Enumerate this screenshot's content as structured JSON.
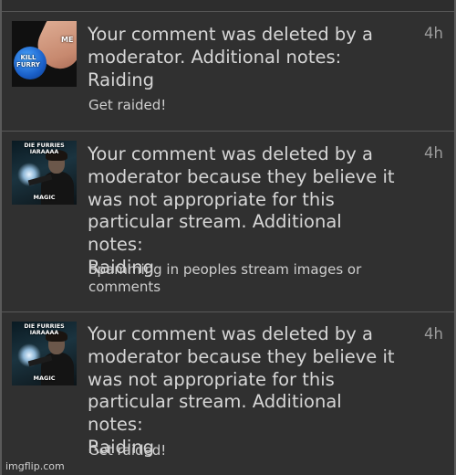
{
  "notifications": [
    {
      "message": "Your comment was deleted by a\nmoderator. Additional notes:\nRaiding",
      "note": "Get raided!",
      "time": "4h",
      "thumb": {
        "top_caption": "ME",
        "bottom_caption": "KILL FURRY"
      }
    },
    {
      "message": "Your comment was deleted by a\nmoderator because they believe it\nwas not appropriate for this\nparticular stream. Additional notes:\nRaiding",
      "note": "Spamming in peoples stream images or\ncomments",
      "time": "4h",
      "thumb": {
        "top_caption": "DIE FURRIES IARAAAA",
        "bottom_caption": "MAGIC"
      }
    },
    {
      "message": "Your comment was deleted by a\nmoderator because they believe it\nwas not appropriate for this\nparticular stream. Additional notes:\nRaiding",
      "note": "Get raided!",
      "time": "4h",
      "thumb": {
        "top_caption": "DIE FURRIES IARAAAA",
        "bottom_caption": "MAGIC"
      }
    }
  ],
  "watermark": "imgflip.com"
}
